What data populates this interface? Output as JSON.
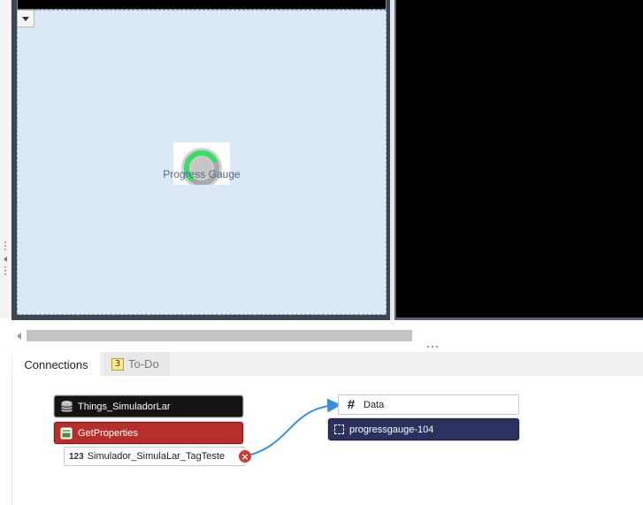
{
  "canvas": {
    "widget": {
      "label": "Progress Gauge",
      "progress_fraction": 0.72,
      "accent_color": "#3ddc6a"
    }
  },
  "tabs": [
    {
      "label": "Connections",
      "active": true
    },
    {
      "label": "To-Do",
      "active": false,
      "badge": "3"
    }
  ],
  "connections": {
    "source": {
      "thing": {
        "label": "Things_SimuladorLar",
        "icon": "database-icon",
        "color": "#141414"
      },
      "service": {
        "label": "GetProperties",
        "icon": "service-icon",
        "color": "#b5302d"
      },
      "field": {
        "type": "123",
        "label": "Simulador_SimulaLar_TagTeste"
      }
    },
    "target": {
      "property": {
        "label": "Data",
        "icon": "hash-icon"
      },
      "widget": {
        "label": "progressgauge-104",
        "icon": "widget-icon",
        "color": "#2b3260"
      }
    },
    "link_color": "#3b8fd9"
  }
}
